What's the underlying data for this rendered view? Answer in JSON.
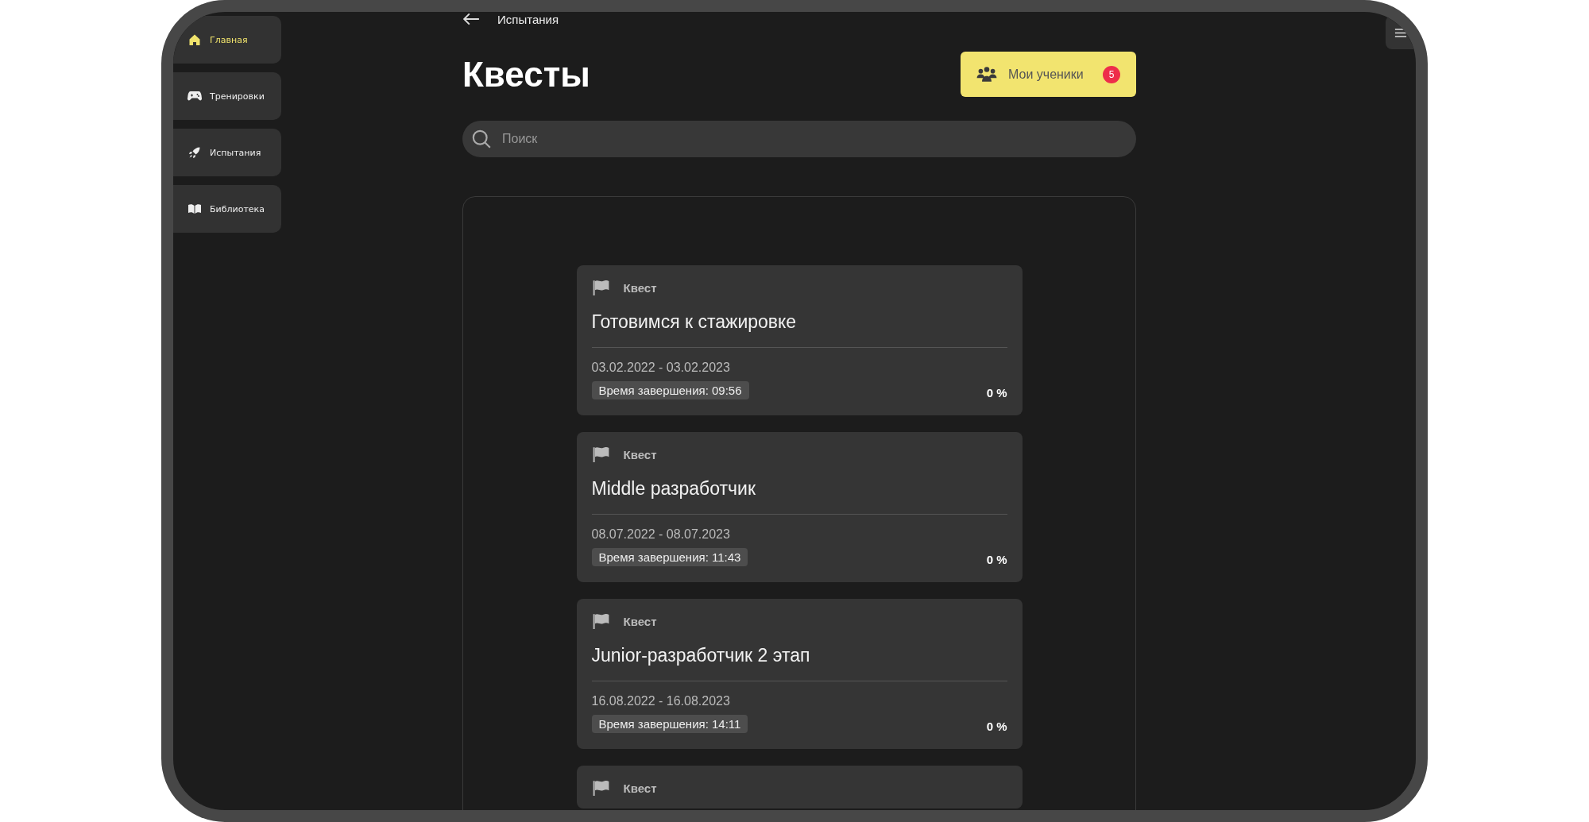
{
  "sidebar": {
    "items": [
      {
        "label": "Главная",
        "selected": true
      },
      {
        "label": "Тренировки",
        "selected": false
      },
      {
        "label": "Испытания",
        "selected": false
      },
      {
        "label": "Библиотека",
        "selected": false
      }
    ]
  },
  "breadcrumb": "Испытания",
  "title": "Квесты",
  "students_button": {
    "label": "Мои ученики",
    "badge": "5"
  },
  "search": {
    "placeholder": "Поиск"
  },
  "quests": [
    {
      "type": "Квест",
      "title": "Готовимся к стажировке",
      "dates": "03.02.2022 - 03.02.2023",
      "finish_time": "Время завершения: 09:56",
      "progress": "0 %"
    },
    {
      "type": "Квест",
      "title": "Middle разработчик",
      "dates": "08.07.2022 - 08.07.2023",
      "finish_time": "Время завершения: 11:43",
      "progress": "0 %"
    },
    {
      "type": "Квест",
      "title": "Junior-разработчик 2 этап",
      "dates": "16.08.2022 - 16.08.2023",
      "finish_time": "Время завершения: 14:11",
      "progress": "0 %"
    },
    {
      "type": "Квест"
    }
  ]
}
